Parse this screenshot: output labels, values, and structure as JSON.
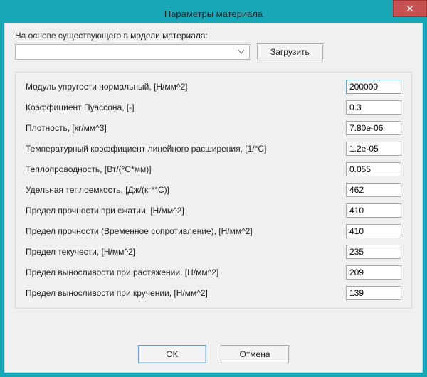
{
  "window": {
    "title": "Параметры материала"
  },
  "source": {
    "label": "На основе существующего в модели материала:",
    "selected": "",
    "load_button": "Загрузить"
  },
  "params": [
    {
      "label": "Модуль упругости нормальный, [Н/мм^2]",
      "value": "200000"
    },
    {
      "label": "Коэффициент Пуассона, [-]",
      "value": "0.3"
    },
    {
      "label": "Плотность, [кг/мм^3]",
      "value": "7.80e-06"
    },
    {
      "label": "Температурный коэффициент линейного расширения, [1/°C]",
      "value": "1.2e-05"
    },
    {
      "label": "Теплопроводность, [Вт/(°C*мм)]",
      "value": "0.055"
    },
    {
      "label": "Удельная теплоемкость, [Дж/(кг*°C)]",
      "value": "462"
    },
    {
      "label": "Предел прочности при сжатии, [Н/мм^2]",
      "value": "410"
    },
    {
      "label": "Предел прочности (Временное сопротивление), [Н/мм^2]",
      "value": "410"
    },
    {
      "label": "Предел текучести, [Н/мм^2]",
      "value": "235"
    },
    {
      "label": "Предел выносливости при растяжении, [Н/мм^2]",
      "value": "209"
    },
    {
      "label": "Предел выносливости при кручении, [Н/мм^2]",
      "value": "139"
    }
  ],
  "footer": {
    "ok": "OK",
    "cancel": "Отмена"
  }
}
